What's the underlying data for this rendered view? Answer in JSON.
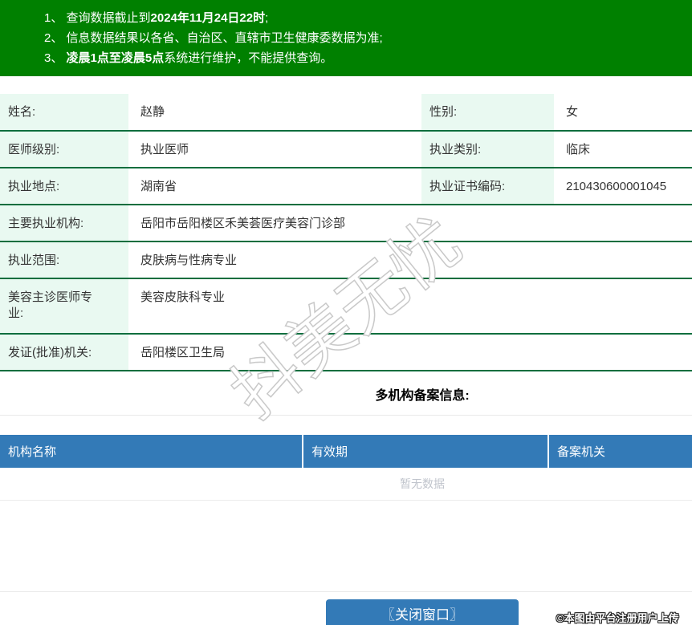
{
  "banner": {
    "notices": [
      {
        "pre": "1、 查询数据截止到",
        "bold": "2024年11月24日22时",
        "post": ";"
      },
      {
        "pre": "2、 信息数据结果以各省、自治区、直辖市卫生健康委数据为准;",
        "bold": "",
        "post": ""
      },
      {
        "pre": "3、 ",
        "bold": "凌晨1点至凌晨5点",
        "post": "系统进行维护，不能提供查询。"
      }
    ]
  },
  "info": {
    "rows": [
      {
        "label": "姓名:",
        "value": "赵静",
        "label2": "性别:",
        "value2": "女"
      },
      {
        "label": "医师级别:",
        "value": "执业医师",
        "label2": "执业类别:",
        "value2": "临床"
      },
      {
        "label": "执业地点:",
        "value": "湖南省",
        "label2": "执业证书编码:",
        "value2": "210430600001045"
      },
      {
        "label": "主要执业机构:",
        "value": "岳阳市岳阳楼区禾美荟医疗美容门诊部"
      },
      {
        "label": "执业范围:",
        "value": "皮肤病与性病专业"
      },
      {
        "label": "美容主诊医师专业:",
        "value": "美容皮肤科专业"
      },
      {
        "label": "发证(批准)机关:",
        "value": "岳阳楼区卫生局"
      }
    ]
  },
  "records": {
    "title": "多机构备案信息:",
    "columns": [
      "机构名称",
      "有效期",
      "备案机关"
    ],
    "empty_text": "暂无数据"
  },
  "footer": {
    "close_button": "〖关闭窗口〗",
    "stamp": "©本图由平台注册用户上传"
  },
  "watermark": {
    "text": "抖美无忧"
  },
  "colors": {
    "banner_green": "#008000",
    "row_line_green": "#0c6e3e",
    "label_mint": "#e9f9f1",
    "header_blue": "#337ab7",
    "empty_gray": "#c0c4cc"
  }
}
